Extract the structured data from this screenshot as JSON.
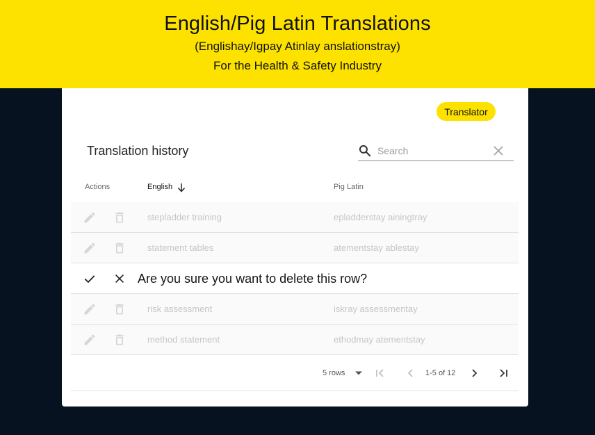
{
  "header": {
    "title": "English/Pig Latin Translations",
    "subtitle": "(Englishay/Igpay Atinlay anslationstray)",
    "tagline": "For the Health & Safety Industry"
  },
  "translator_button": "Translator",
  "history": {
    "title": "Translation history",
    "search_placeholder": "Search"
  },
  "table": {
    "columns": {
      "actions": "Actions",
      "english": "English",
      "pig_latin": "Pig Latin"
    },
    "sort": {
      "column": "English",
      "direction": "descending"
    },
    "rows": [
      {
        "english": "stepladder training",
        "pig_latin": "epladderstay ainingtray"
      },
      {
        "english": "statement tables",
        "pig_latin": "atementstay ablestay"
      },
      {
        "confirm_message": "Are you sure you want to delete this row?"
      },
      {
        "english": "risk assessment",
        "pig_latin": "iskray assessmentay"
      },
      {
        "english": "method statement",
        "pig_latin": "ethodmay atementstay"
      }
    ]
  },
  "pagination": {
    "rows_per_page": "5 rows",
    "range": "1-5 of 12"
  },
  "colors": {
    "banner": "#fde200",
    "background": "#061220",
    "card": "#ffffff"
  }
}
